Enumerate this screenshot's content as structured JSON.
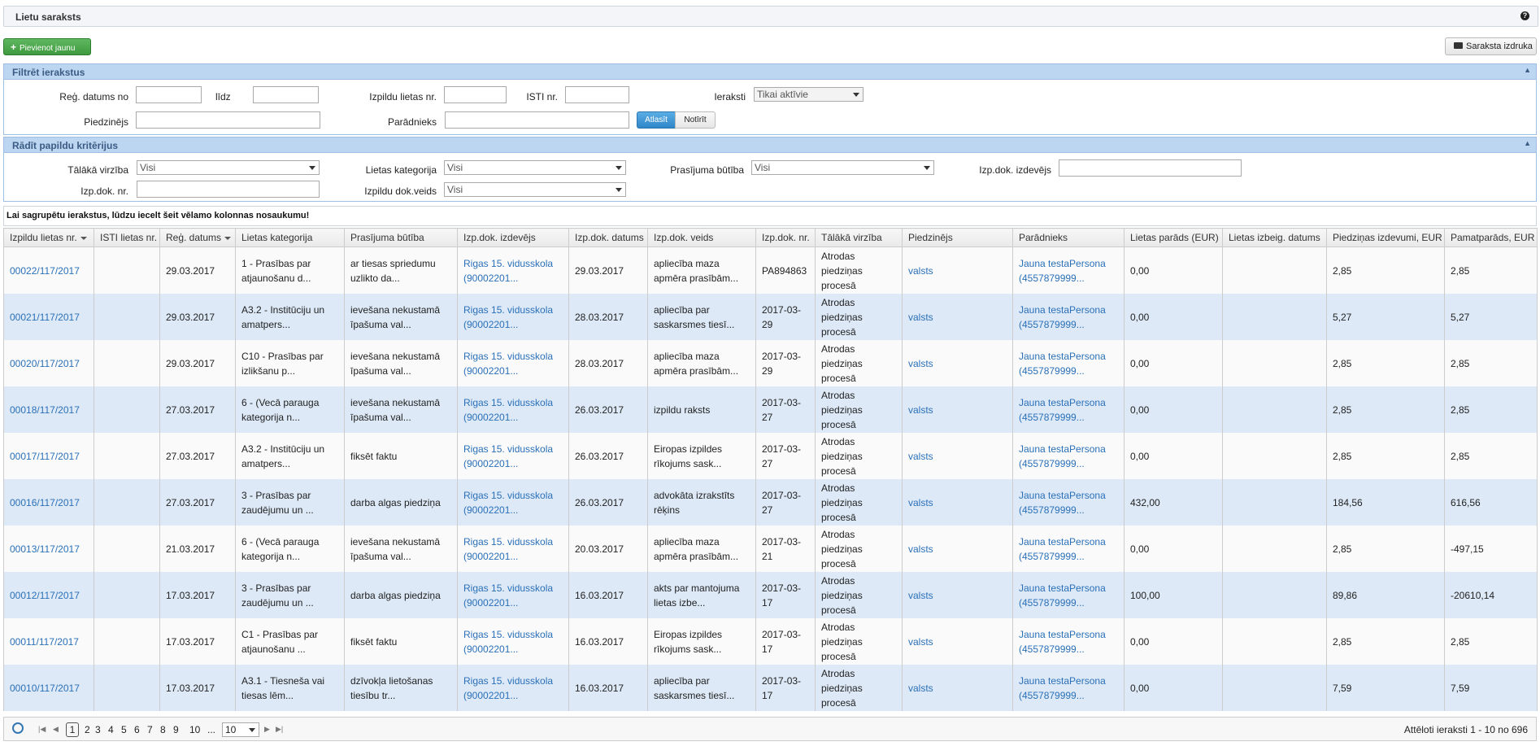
{
  "header": {
    "title": "Lietu saraksts",
    "help": "?"
  },
  "toolbar": {
    "add_label": "Pievienot jaunu",
    "print_label": "Saraksta izdruka"
  },
  "filter": {
    "title": "Filtrēt ierakstus",
    "reg_from_label": "Reģ. datums no",
    "reg_to_label": "līdz",
    "case_no_label": "Izpildu lietas nr.",
    "isti_label": "ISTI nr.",
    "records_label": "Ieraksti",
    "records_value": "Tikai aktīvie",
    "claimant_label": "Piedzinējs",
    "debtor_label": "Parādnieks",
    "apply_label": "Atlasīt",
    "clear_label": "Notīrīt"
  },
  "extra": {
    "title": "Rādīt papildu kritērijus",
    "next_label": "Tālākā virzība",
    "next_value": "Visi",
    "category_label": "Lietas kategorija",
    "category_value": "Visi",
    "claim_label": "Prasījuma būtība",
    "claim_value": "Visi",
    "issuer_label": "Izp.dok. izdevējs",
    "docno_label": "Izp.dok. nr.",
    "doctype_label": "Izpildu dok.veids",
    "doctype_value": "Visi"
  },
  "group_hint": "Lai sagrupētu ierakstus, lūdzu iecelt šeit vēlamo kolonnas nosaukumu!",
  "table": {
    "columns": [
      "Izpildu lietas nr.",
      "ISTI lietas nr.",
      "Reģ. datums",
      "Lietas kategorija",
      "Prasījuma būtība",
      "Izp.dok. izdevējs",
      "Izp.dok. datums",
      "Izp.dok. veids",
      "Izp.dok. nr.",
      "Tālākā virzība",
      "Piedzinējs",
      "Parādnieks",
      "Lietas parāds (EUR)",
      "Lietas izbeig. datums",
      "Piedziņas izdevumi, EUR",
      "Pamatparāds, EUR"
    ],
    "rows": [
      [
        "00022/117/2017",
        "",
        "29.03.2017",
        "1 - Prasības par atjaunošanu d...",
        "ar tiesas spriedumu uzlikto da...",
        "Rigas 15. vidusskola (90002201...",
        "29.03.2017",
        "apliecība maza apmēra prasībām...",
        "PA894863",
        "Atrodas piedziņas procesā",
        "valsts",
        "Jauna testaPersona (4557879999...",
        "0,00",
        "",
        "2,85",
        "2,85"
      ],
      [
        "00021/117/2017",
        "",
        "29.03.2017",
        "A3.2 - Institūciju un amatpers...",
        "ievešana nekustamā īpašuma val...",
        "Rigas 15. vidusskola (90002201...",
        "28.03.2017",
        "apliecība par saskarsmes tiesī...",
        "2017-03-29",
        "Atrodas piedziņas procesā",
        "valsts",
        "Jauna testaPersona (4557879999...",
        "0,00",
        "",
        "5,27",
        "5,27"
      ],
      [
        "00020/117/2017",
        "",
        "29.03.2017",
        "C10 - Prasības par izlikšanu p...",
        "ievešana nekustamā īpašuma val...",
        "Rigas 15. vidusskola (90002201...",
        "28.03.2017",
        "apliecība maza apmēra prasībām...",
        "2017-03-29",
        "Atrodas piedziņas procesā",
        "valsts",
        "Jauna testaPersona (4557879999...",
        "0,00",
        "",
        "2,85",
        "2,85"
      ],
      [
        "00018/117/2017",
        "",
        "27.03.2017",
        "6 - (Vecā parauga kategorija n...",
        "ievešana nekustamā īpašuma val...",
        "Rigas 15. vidusskola (90002201...",
        "26.03.2017",
        "izpildu raksts",
        "2017-03-27",
        "Atrodas piedziņas procesā",
        "valsts",
        "Jauna testaPersona (4557879999...",
        "0,00",
        "",
        "2,85",
        "2,85"
      ],
      [
        "00017/117/2017",
        "",
        "27.03.2017",
        "A3.2 - Institūciju un amatpers...",
        "fiksēt faktu",
        "Rigas 15. vidusskola (90002201...",
        "26.03.2017",
        "Eiropas izpildes rīkojums sask...",
        "2017-03-27",
        "Atrodas piedziņas procesā",
        "valsts",
        "Jauna testaPersona (4557879999...",
        "0,00",
        "",
        "2,85",
        "2,85"
      ],
      [
        "00016/117/2017",
        "",
        "27.03.2017",
        "3 - Prasības par zaudējumu un ...",
        "darba algas piedziņa",
        "Rigas 15. vidusskola (90002201...",
        "26.03.2017",
        "advokāta izrakstīts rēķins",
        "2017-03-27",
        "Atrodas piedziņas procesā",
        "valsts",
        "Jauna testaPersona (4557879999...",
        "432,00",
        "",
        "184,56",
        "616,56"
      ],
      [
        "00013/117/2017",
        "",
        "21.03.2017",
        "6 - (Vecā parauga kategorija n...",
        "ievešana nekustamā īpašuma val...",
        "Rigas 15. vidusskola (90002201...",
        "20.03.2017",
        "apliecība maza apmēra prasībām...",
        "2017-03-21",
        "Atrodas piedziņas procesā",
        "valsts",
        "Jauna testaPersona (4557879999...",
        "0,00",
        "",
        "2,85",
        "-497,15"
      ],
      [
        "00012/117/2017",
        "",
        "17.03.2017",
        "3 - Prasības par zaudējumu un ...",
        "darba algas piedziņa",
        "Rigas 15. vidusskola (90002201...",
        "16.03.2017",
        "akts par mantojuma lietas izbe...",
        "2017-03-17",
        "Atrodas piedziņas procesā",
        "valsts",
        "Jauna testaPersona (4557879999...",
        "100,00",
        "",
        "89,86",
        "-20610,14"
      ],
      [
        "00011/117/2017",
        "",
        "17.03.2017",
        "C1 - Prasības par atjaunošanu ...",
        "fiksēt faktu",
        "Rigas 15. vidusskola (90002201...",
        "16.03.2017",
        "Eiropas izpildes rīkojums sask...",
        "2017-03-17",
        "Atrodas piedziņas procesā",
        "valsts",
        "Jauna testaPersona (4557879999...",
        "0,00",
        "",
        "2,85",
        "2,85"
      ],
      [
        "00010/117/2017",
        "",
        "17.03.2017",
        "A3.1 - Tiesneša vai tiesas lēm...",
        "dzīvokļa lietošanas tiesību tr...",
        "Rigas 15. vidusskola (90002201...",
        "16.03.2017",
        "apliecība par saskarsmes tiesī...",
        "2017-03-17",
        "Atrodas piedziņas procesā",
        "valsts",
        "Jauna testaPersona (4557879999...",
        "0,00",
        "",
        "7,59",
        "7,59"
      ]
    ]
  },
  "pager": {
    "pages": [
      "1",
      "2",
      "3",
      "4",
      "5",
      "6",
      "7",
      "8",
      "9",
      "10",
      "..."
    ],
    "page_size": "10",
    "info": "Attēloti ieraksti 1 - 10 no 696"
  }
}
